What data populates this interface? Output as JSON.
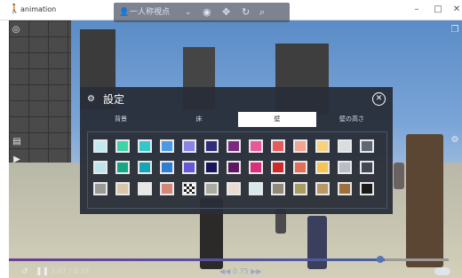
{
  "window": {
    "title": "animation",
    "minimize": "–",
    "maximize": "□",
    "close": "✕",
    "app_icon": "walker-icon"
  },
  "toolbar": {
    "view_label": "一人称視点",
    "dropdown_icon": "chevron-down-icon"
  },
  "settings": {
    "title": "設定",
    "tabs": [
      {
        "label": "背景",
        "active": false
      },
      {
        "label": "床",
        "active": false
      },
      {
        "label": "壁",
        "active": true
      },
      {
        "label": "壁の高さ",
        "active": false
      }
    ],
    "swatch_rows": [
      [
        "#bfeaf2",
        "#3fd4a8",
        "#33c9cc",
        "#4a9be6",
        "#8a84ea",
        "#2f2f7c",
        "#7b2b7f",
        "#e9589c",
        "#e55a5a",
        "#f3a392",
        "#f6d37a",
        "#d9dde2",
        "#5e6873"
      ],
      [
        "#bde6ea",
        "#16a884",
        "#14a5b6",
        "#2f7ed6",
        "#6857d9",
        "#17165a",
        "#5f1660",
        "#db2f7a",
        "#cf2a2a",
        "#e26e53",
        "#f5c452",
        "#b8bec6",
        "#404954"
      ],
      [
        "#9a9a95",
        "#d8c6aa",
        "#e8e8e8",
        "#d48777",
        "#777777",
        "#a9aaa0",
        "#e8ddd0",
        "#d5e9e8",
        "#8f8a78",
        "#a79c62",
        "#b59863",
        "#9f6f3c",
        "#1a1a1a"
      ]
    ]
  },
  "player": {
    "time": "3:47 / 4:37",
    "speed": "◀◀ 0.75 ▶▶",
    "progress": 0.83
  }
}
